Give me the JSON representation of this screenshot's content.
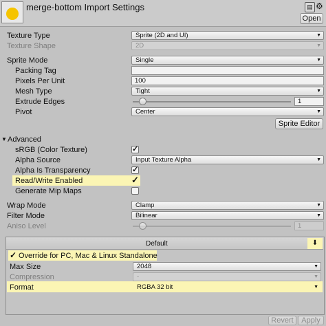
{
  "window": {
    "title": "merge-bottom Import Settings",
    "open_label": "Open"
  },
  "fields": {
    "texture_type": {
      "label": "Texture Type",
      "value": "Sprite (2D and UI)"
    },
    "texture_shape": {
      "label": "Texture Shape",
      "value": "2D"
    },
    "sprite_mode": {
      "label": "Sprite Mode",
      "value": "Single"
    },
    "packing_tag": {
      "label": "Packing Tag",
      "value": ""
    },
    "pixels_per_unit": {
      "label": "Pixels Per Unit",
      "value": "100"
    },
    "mesh_type": {
      "label": "Mesh Type",
      "value": "Tight"
    },
    "extrude_edges": {
      "label": "Extrude Edges",
      "value": "1",
      "slider_fraction": 0.06
    },
    "pivot": {
      "label": "Pivot",
      "value": "Center"
    },
    "sprite_editor_label": "Sprite Editor"
  },
  "advanced": {
    "label": "Advanced",
    "srgb": {
      "label": "sRGB (Color Texture)",
      "checked": true
    },
    "alpha_source": {
      "label": "Alpha Source",
      "value": "Input Texture Alpha"
    },
    "alpha_is_transparency": {
      "label": "Alpha Is Transparency",
      "checked": true
    },
    "read_write": {
      "label": "Read/Write Enabled",
      "checked": true
    },
    "generate_mip_maps": {
      "label": "Generate Mip Maps",
      "checked": false
    }
  },
  "wrap_mode": {
    "label": "Wrap Mode",
    "value": "Clamp"
  },
  "filter_mode": {
    "label": "Filter Mode",
    "value": "Bilinear"
  },
  "aniso_level": {
    "label": "Aniso Level",
    "value": "1",
    "slider_fraction": 0.06
  },
  "platform": {
    "default_tab": "Default",
    "override_label": "Override for PC, Mac & Linux Standalone",
    "override_checked": true,
    "max_size": {
      "label": "Max Size",
      "value": "2048"
    },
    "compression": {
      "label": "Compression",
      "value": "-"
    },
    "format": {
      "label": "Format",
      "value": "RGBA 32 bit"
    }
  },
  "footer": {
    "revert_label": "Revert",
    "apply_label": "Apply"
  },
  "check_glyph": "✓",
  "colors": {
    "highlight": "#fbf5b4",
    "thumbnail_circle": "#f5c400"
  }
}
